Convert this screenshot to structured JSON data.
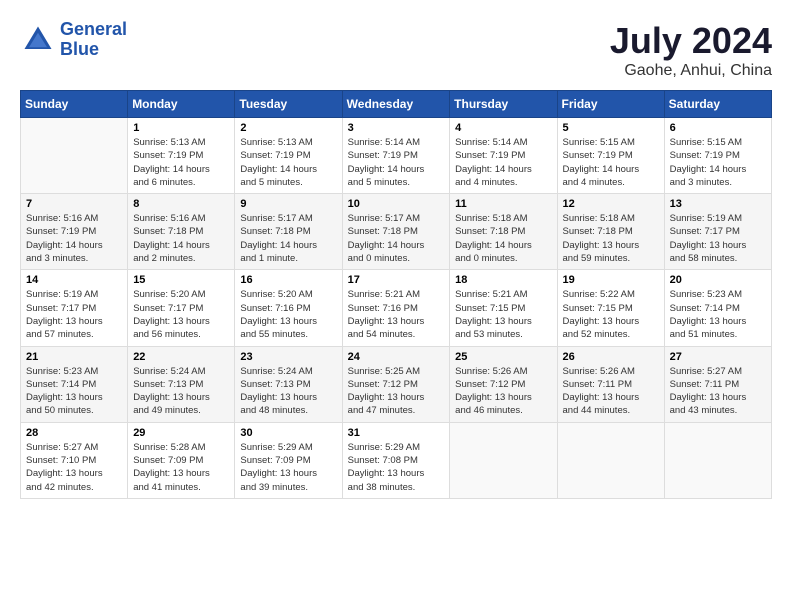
{
  "header": {
    "logo_line1": "General",
    "logo_line2": "Blue",
    "main_title": "July 2024",
    "subtitle": "Gaohe, Anhui, China"
  },
  "calendar": {
    "days_of_week": [
      "Sunday",
      "Monday",
      "Tuesday",
      "Wednesday",
      "Thursday",
      "Friday",
      "Saturday"
    ],
    "weeks": [
      [
        {
          "day": "",
          "info": ""
        },
        {
          "day": "1",
          "info": "Sunrise: 5:13 AM\nSunset: 7:19 PM\nDaylight: 14 hours\nand 6 minutes."
        },
        {
          "day": "2",
          "info": "Sunrise: 5:13 AM\nSunset: 7:19 PM\nDaylight: 14 hours\nand 5 minutes."
        },
        {
          "day": "3",
          "info": "Sunrise: 5:14 AM\nSunset: 7:19 PM\nDaylight: 14 hours\nand 5 minutes."
        },
        {
          "day": "4",
          "info": "Sunrise: 5:14 AM\nSunset: 7:19 PM\nDaylight: 14 hours\nand 4 minutes."
        },
        {
          "day": "5",
          "info": "Sunrise: 5:15 AM\nSunset: 7:19 PM\nDaylight: 14 hours\nand 4 minutes."
        },
        {
          "day": "6",
          "info": "Sunrise: 5:15 AM\nSunset: 7:19 PM\nDaylight: 14 hours\nand 3 minutes."
        }
      ],
      [
        {
          "day": "7",
          "info": "Sunrise: 5:16 AM\nSunset: 7:19 PM\nDaylight: 14 hours\nand 3 minutes."
        },
        {
          "day": "8",
          "info": "Sunrise: 5:16 AM\nSunset: 7:18 PM\nDaylight: 14 hours\nand 2 minutes."
        },
        {
          "day": "9",
          "info": "Sunrise: 5:17 AM\nSunset: 7:18 PM\nDaylight: 14 hours\nand 1 minute."
        },
        {
          "day": "10",
          "info": "Sunrise: 5:17 AM\nSunset: 7:18 PM\nDaylight: 14 hours\nand 0 minutes."
        },
        {
          "day": "11",
          "info": "Sunrise: 5:18 AM\nSunset: 7:18 PM\nDaylight: 14 hours\nand 0 minutes."
        },
        {
          "day": "12",
          "info": "Sunrise: 5:18 AM\nSunset: 7:18 PM\nDaylight: 13 hours\nand 59 minutes."
        },
        {
          "day": "13",
          "info": "Sunrise: 5:19 AM\nSunset: 7:17 PM\nDaylight: 13 hours\nand 58 minutes."
        }
      ],
      [
        {
          "day": "14",
          "info": "Sunrise: 5:19 AM\nSunset: 7:17 PM\nDaylight: 13 hours\nand 57 minutes."
        },
        {
          "day": "15",
          "info": "Sunrise: 5:20 AM\nSunset: 7:17 PM\nDaylight: 13 hours\nand 56 minutes."
        },
        {
          "day": "16",
          "info": "Sunrise: 5:20 AM\nSunset: 7:16 PM\nDaylight: 13 hours\nand 55 minutes."
        },
        {
          "day": "17",
          "info": "Sunrise: 5:21 AM\nSunset: 7:16 PM\nDaylight: 13 hours\nand 54 minutes."
        },
        {
          "day": "18",
          "info": "Sunrise: 5:21 AM\nSunset: 7:15 PM\nDaylight: 13 hours\nand 53 minutes."
        },
        {
          "day": "19",
          "info": "Sunrise: 5:22 AM\nSunset: 7:15 PM\nDaylight: 13 hours\nand 52 minutes."
        },
        {
          "day": "20",
          "info": "Sunrise: 5:23 AM\nSunset: 7:14 PM\nDaylight: 13 hours\nand 51 minutes."
        }
      ],
      [
        {
          "day": "21",
          "info": "Sunrise: 5:23 AM\nSunset: 7:14 PM\nDaylight: 13 hours\nand 50 minutes."
        },
        {
          "day": "22",
          "info": "Sunrise: 5:24 AM\nSunset: 7:13 PM\nDaylight: 13 hours\nand 49 minutes."
        },
        {
          "day": "23",
          "info": "Sunrise: 5:24 AM\nSunset: 7:13 PM\nDaylight: 13 hours\nand 48 minutes."
        },
        {
          "day": "24",
          "info": "Sunrise: 5:25 AM\nSunset: 7:12 PM\nDaylight: 13 hours\nand 47 minutes."
        },
        {
          "day": "25",
          "info": "Sunrise: 5:26 AM\nSunset: 7:12 PM\nDaylight: 13 hours\nand 46 minutes."
        },
        {
          "day": "26",
          "info": "Sunrise: 5:26 AM\nSunset: 7:11 PM\nDaylight: 13 hours\nand 44 minutes."
        },
        {
          "day": "27",
          "info": "Sunrise: 5:27 AM\nSunset: 7:11 PM\nDaylight: 13 hours\nand 43 minutes."
        }
      ],
      [
        {
          "day": "28",
          "info": "Sunrise: 5:27 AM\nSunset: 7:10 PM\nDaylight: 13 hours\nand 42 minutes."
        },
        {
          "day": "29",
          "info": "Sunrise: 5:28 AM\nSunset: 7:09 PM\nDaylight: 13 hours\nand 41 minutes."
        },
        {
          "day": "30",
          "info": "Sunrise: 5:29 AM\nSunset: 7:09 PM\nDaylight: 13 hours\nand 39 minutes."
        },
        {
          "day": "31",
          "info": "Sunrise: 5:29 AM\nSunset: 7:08 PM\nDaylight: 13 hours\nand 38 minutes."
        },
        {
          "day": "",
          "info": ""
        },
        {
          "day": "",
          "info": ""
        },
        {
          "day": "",
          "info": ""
        }
      ]
    ]
  }
}
